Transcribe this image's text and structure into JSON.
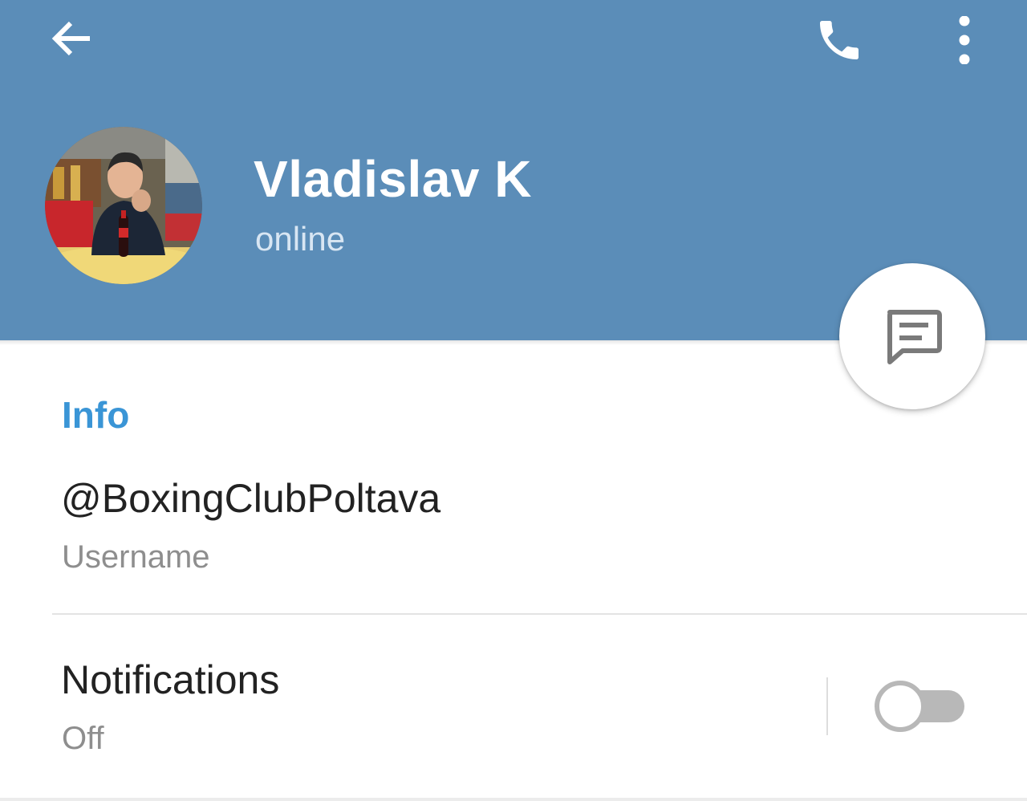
{
  "colors": {
    "header": "#5b8db8",
    "accent": "#3a95d6",
    "icon_on_header": "#ffffff",
    "fab_icon": "#7a7a7a",
    "toggle_off": "#b8b8b8"
  },
  "toolbar": {
    "back_icon": "arrow-left-icon",
    "call_icon": "phone-icon",
    "menu_icon": "more-vertical-icon"
  },
  "profile": {
    "name": "Vladislav K",
    "status": "online",
    "avatar": "user-photo"
  },
  "fab": {
    "icon": "message-icon"
  },
  "info": {
    "section_title": "Info",
    "username_value": "@BoxingClubPoltava",
    "username_label": "Username"
  },
  "notifications": {
    "title": "Notifications",
    "value": "Off",
    "toggle_on": false
  }
}
